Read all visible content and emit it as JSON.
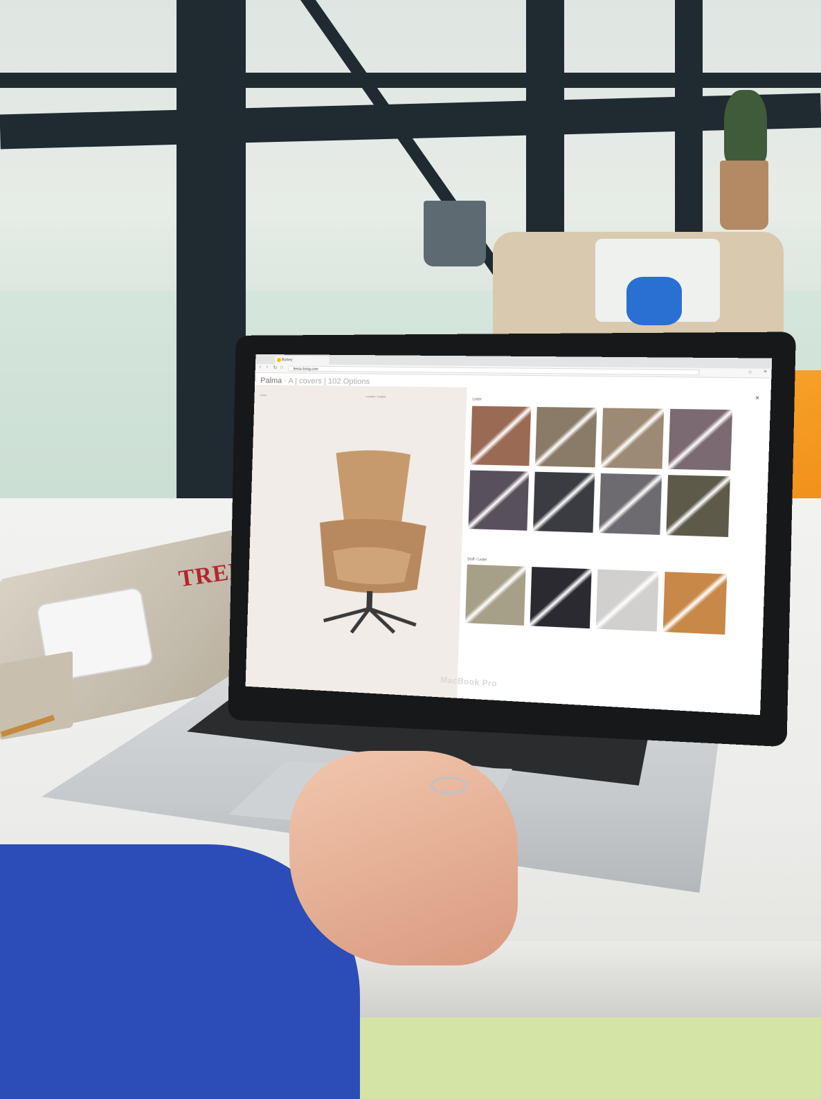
{
  "browser": {
    "tab_title": "Burkey",
    "url": "leesa-living.com"
  },
  "page": {
    "title_main": "Palma",
    "title_sub": "· A | covers | 102 Options",
    "select_left": "Color",
    "select_right": "Leather / Fabric"
  },
  "sections": {
    "leather_label": "Leder",
    "fabric_label": "Stoff / Leder"
  },
  "swatches_row1": [
    "#9b6a55",
    "#8a7b69",
    "#9d8a74",
    "#7c6a72"
  ],
  "swatches_row2": [
    "#58505a",
    "#3b3c41",
    "#6d6b70",
    "#5d5a4a"
  ],
  "swatches_row3": [
    "#a7a089",
    "#2c2a31",
    "#d1d0cf",
    "#c88848"
  ],
  "chair_color": "#c79a6d",
  "laptop_brand": "MacBook Pro",
  "magazine_title": "TREE"
}
